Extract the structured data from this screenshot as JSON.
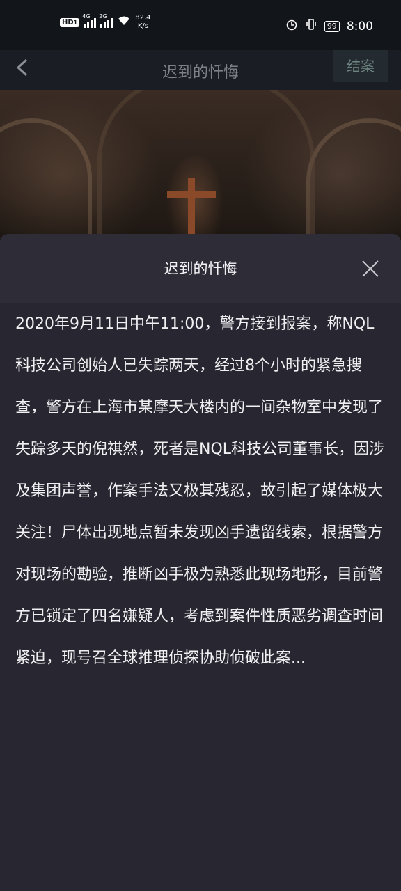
{
  "status_bar": {
    "hd": "HD",
    "hd_sub": "1",
    "sim1": "4G",
    "sim2": "2G",
    "speed_value": "82.4",
    "speed_unit": "K/s",
    "battery": "99",
    "time": "8:00"
  },
  "app_bar": {
    "title": "迟到的忏悔",
    "close_case_label": "结案"
  },
  "sheet": {
    "title": "迟到的忏悔",
    "story": "2020年9月11日中午11:00，警方接到报案，称NQL科技公司创始人已失踪两天，经过8个小时的紧急搜查，警方在上海市某摩天大楼内的一间杂物室中发现了失踪多天的倪祺然，死者是NQL科技公司董事长，因涉及集团声誉，作案手法又极其残忍，故引起了媒体极大关注！尸体出现地点暂未发现凶手遗留线索，根据警方对现场的勘验，推断凶手极为熟悉此现场地形，目前警方已锁定了四名嫌疑人，考虑到案件性质恶劣调查时间紧迫，现号召全球推理侦探协助侦破此案..."
  }
}
